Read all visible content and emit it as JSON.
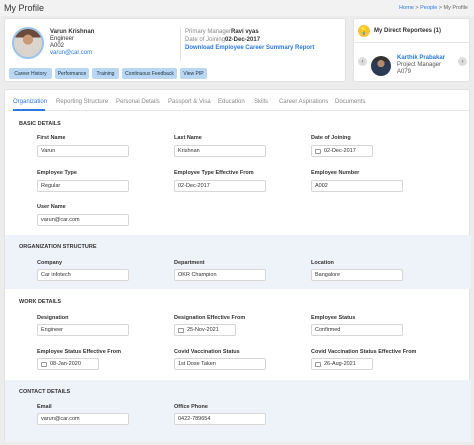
{
  "page": {
    "title": "My Profile",
    "breadcrumb": [
      "Home",
      "People",
      "My Profile"
    ],
    "sep": ">"
  },
  "profile": {
    "name": "Varun Krishnan",
    "role": "Engineer",
    "emp_id": "A002",
    "email": "varun@car.com",
    "pm_label": "Primary Manager",
    "pm_value": "Ravi vyas",
    "doj_label": "Date of Joining",
    "doj_value": "02-Dec-2017",
    "download": "Download Employee Career Summary Report",
    "buttons": [
      "Career History",
      "Performance",
      "Training",
      "Continuous Feedback",
      "View PIP"
    ]
  },
  "reportees": {
    "title": "My Direct Reportees (1)",
    "name": "Karthik Prabakar",
    "role": "Project Manager",
    "id": "A079",
    "prev": "‹",
    "next": "›",
    "bulb": "💡"
  },
  "tabs": [
    "Organization",
    "Reporting Structure",
    "Personal Details",
    "Passport & Visa",
    "Education",
    "Skills",
    "Career Aspirations",
    "Documents"
  ],
  "basic": {
    "title": "BASIC DETAILS",
    "fields": [
      {
        "label": "First Name",
        "value": "Varun"
      },
      {
        "label": "Last Name",
        "value": "Krishnan"
      },
      {
        "label": "Date of Joining",
        "value": "02-Dec-2017"
      },
      {
        "label": "Employee Type",
        "value": "Regular"
      },
      {
        "label": "Employee Type Effective From",
        "value": "02-Dec-2017"
      },
      {
        "label": "Employee Number",
        "value": "A002"
      },
      {
        "label": "User Name",
        "value": "varun@car.com"
      }
    ]
  },
  "org": {
    "title": "ORGANIZATION STRUCTURE",
    "fields": [
      {
        "label": "Company",
        "value": "Car infotech"
      },
      {
        "label": "Department",
        "value": "OKR Champion"
      },
      {
        "label": "Location",
        "value": "Bangalore"
      }
    ]
  },
  "work": {
    "title": "WORK DETAILS",
    "fields": [
      {
        "label": "Designation",
        "value": "Engineer"
      },
      {
        "label": "Designation Effective From",
        "value": "25-Nov-2021"
      },
      {
        "label": "Employee Status",
        "value": "Confirmed"
      },
      {
        "label": "Employee Status Effective From",
        "value": "08-Jan-2020"
      },
      {
        "label": "Covid Vaccination Status",
        "value": "1st Dose Taken"
      },
      {
        "label": "Covid Vaccination Status Effective From",
        "value": "26-Aug-2021"
      }
    ]
  },
  "contact": {
    "title": "CONTACT DETAILS",
    "fields": [
      {
        "label": "Email",
        "value": "varun@car.com"
      },
      {
        "label": "Office Phone",
        "value": "0422-789654"
      }
    ]
  }
}
